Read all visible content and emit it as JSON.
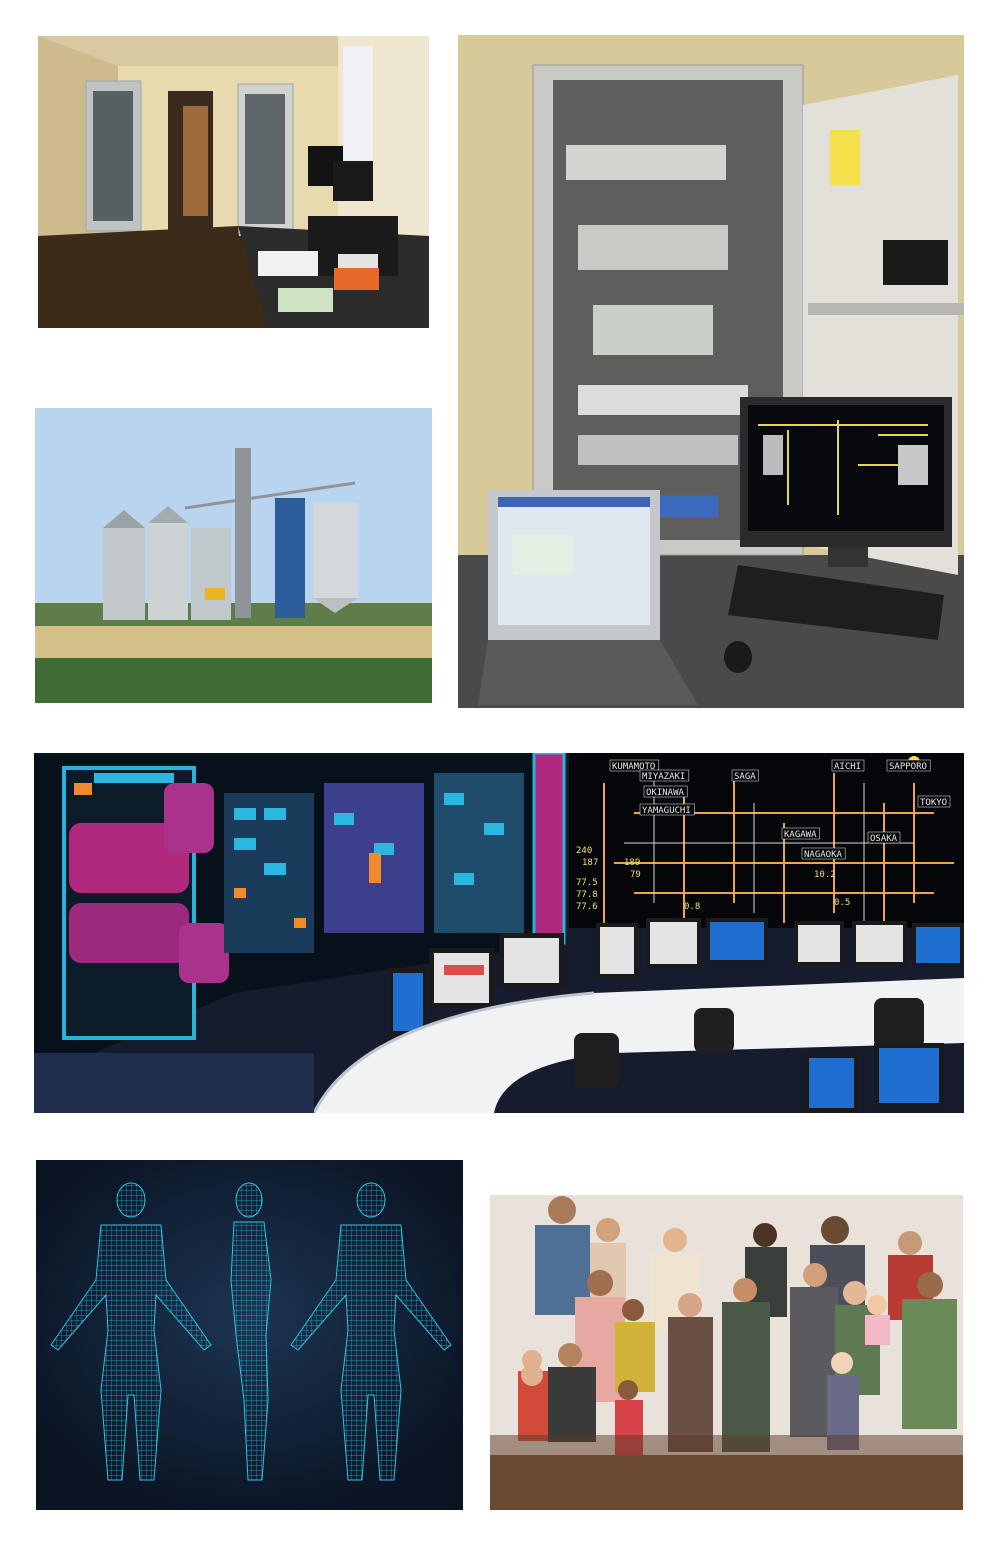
{
  "collage": {
    "photos": [
      {
        "id": "server-room",
        "subject": "server room with rack cabinets and workstation"
      },
      {
        "id": "control-cabinet",
        "subject": "open control cabinet with laptop and monitor"
      },
      {
        "id": "grain-silos",
        "subject": "grain silo facility in a field"
      },
      {
        "id": "control-room",
        "subject": "control room with large mimic display wall"
      },
      {
        "id": "wireframe-bodies",
        "subject": "three wireframe human body models"
      },
      {
        "id": "figurines-group",
        "subject": "group of 3D-printed people figurines"
      }
    ],
    "map_labels": [
      "KUMAMOTO",
      "MIYAZAKI",
      "OKINAWA",
      "YAMAGUCHI",
      "SAGA",
      "AICHI",
      "SAPPORO",
      "TOKYO",
      "KAGAWA",
      "NAGAOKA",
      "OSAKA"
    ],
    "map_numbers": [
      "240",
      "187",
      "189",
      "77.5",
      "79",
      "77.8",
      "77.6",
      "0.8",
      "10.2",
      "0.5"
    ]
  }
}
